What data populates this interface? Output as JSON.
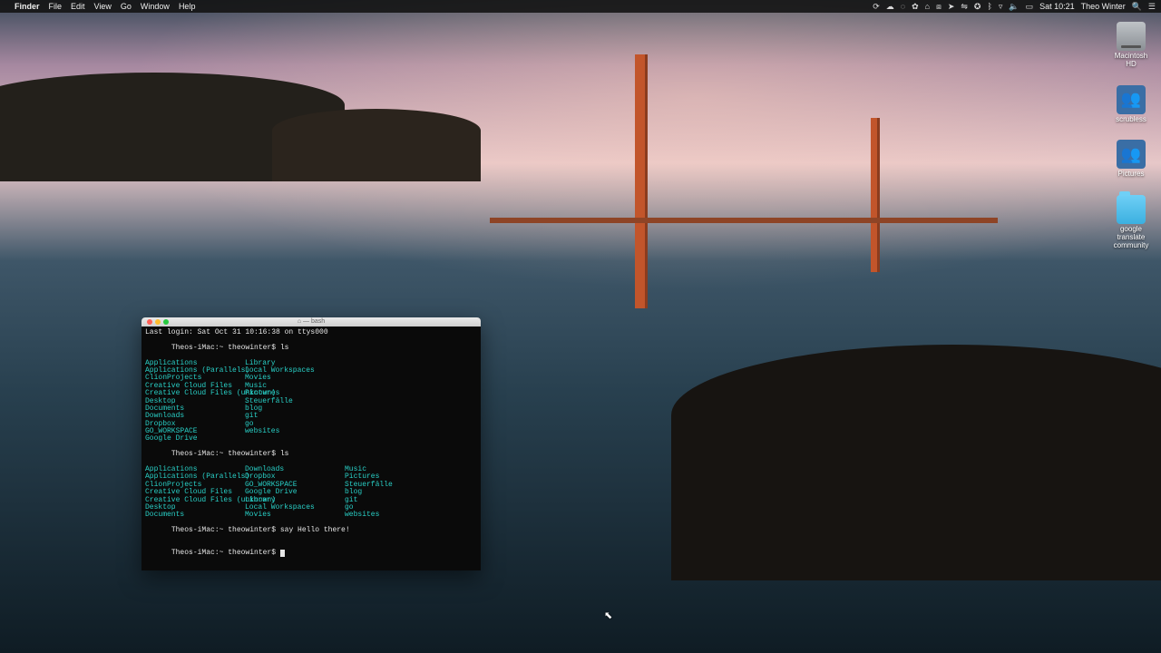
{
  "menubar": {
    "app": "Finder",
    "items": [
      "File",
      "Edit",
      "View",
      "Go",
      "Window",
      "Help"
    ],
    "clock": "Sat 10:21",
    "user": "Theo Winter"
  },
  "desktop_icons": [
    {
      "kind": "disk",
      "label": "Macintosh HD"
    },
    {
      "kind": "shared",
      "label": "scrubless"
    },
    {
      "kind": "shared",
      "label": "Pictures"
    },
    {
      "kind": "folder",
      "label": "google translate community"
    }
  ],
  "terminal": {
    "title": "⌂ — bash",
    "last_login": "Last login: Sat Oct 31 10:16:38 on ttys000",
    "prompt_host": "Theos-iMac:~ theowinter$",
    "cmd1": "ls",
    "ls1": [
      [
        "Applications",
        "Library"
      ],
      [
        "Applications (Parallels)",
        "Local Workspaces"
      ],
      [
        "ClionProjects",
        "Movies"
      ],
      [
        "Creative Cloud Files",
        "Music"
      ],
      [
        "Creative Cloud Files (unknown)",
        "Pictures"
      ],
      [
        "Desktop",
        "Steuerfälle"
      ],
      [
        "Documents",
        "blog"
      ],
      [
        "Downloads",
        "git"
      ],
      [
        "Dropbox",
        "go"
      ],
      [
        "GO_WORKSPACE",
        "websites"
      ],
      [
        "Google Drive",
        ""
      ]
    ],
    "cmd2": "ls",
    "ls2": [
      [
        "Applications",
        "Downloads",
        "Music"
      ],
      [
        "Applications (Parallels)",
        "Dropbox",
        "Pictures"
      ],
      [
        "ClionProjects",
        "GO_WORKSPACE",
        "Steuerfälle"
      ],
      [
        "Creative Cloud Files",
        "Google Drive",
        "blog"
      ],
      [
        "Creative Cloud Files (unknown)",
        "Library",
        "git"
      ],
      [
        "Desktop",
        "Local Workspaces",
        "go"
      ],
      [
        "Documents",
        "Movies",
        "websites"
      ]
    ],
    "cmd3": "say Hello there!"
  }
}
